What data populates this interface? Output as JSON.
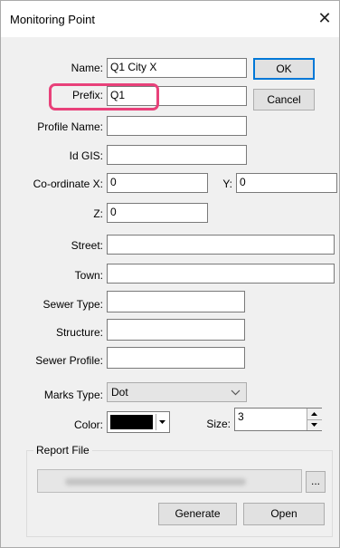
{
  "window": {
    "title": "Monitoring Point",
    "close_glyph": "✕"
  },
  "fields": {
    "name": {
      "label": "Name:",
      "value": "Q1 City X"
    },
    "prefix": {
      "label": "Prefix:",
      "value": "Q1"
    },
    "profile_name": {
      "label": "Profile Name:",
      "value": ""
    },
    "id_gis": {
      "label": "Id GIS:",
      "value": ""
    },
    "coordinate_x": {
      "label": "Co-ordinate  X:",
      "value": "0"
    },
    "coordinate_y": {
      "label": "Y:",
      "value": "0"
    },
    "coordinate_z": {
      "label": "Z:",
      "value": "0"
    },
    "street": {
      "label": "Street:",
      "value": ""
    },
    "town": {
      "label": "Town:",
      "value": ""
    },
    "sewer_type": {
      "label": "Sewer Type:",
      "value": ""
    },
    "structure": {
      "label": "Structure:",
      "value": ""
    },
    "sewer_profile": {
      "label": "Sewer Profile:",
      "value": ""
    },
    "marks_type": {
      "label": "Marks Type:",
      "value": "Dot"
    },
    "color": {
      "label": "Color:",
      "value": "#000000"
    },
    "size": {
      "label": "Size:",
      "value": "3"
    }
  },
  "buttons": {
    "ok": "OK",
    "cancel": "Cancel",
    "generate": "Generate",
    "open": "Open",
    "browse": "..."
  },
  "report_file": {
    "group_label": "Report File"
  },
  "colors": {
    "highlight": "#e8417a",
    "accent": "#0078d7"
  }
}
